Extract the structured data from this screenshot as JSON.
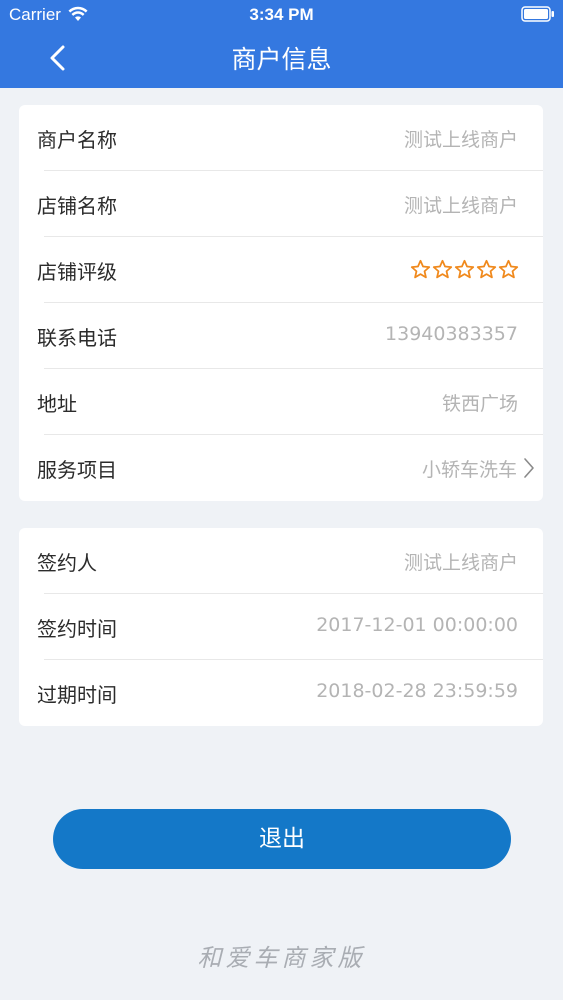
{
  "status_bar": {
    "carrier": "Carrier",
    "time": "3:34 PM"
  },
  "nav": {
    "title": "商户信息",
    "back_icon": "chevron-left-icon"
  },
  "merchant_info": {
    "rows": [
      {
        "label": "商户名称",
        "value": "测试上线商户"
      },
      {
        "label": "店铺名称",
        "value": "测试上线商户"
      },
      {
        "label": "店铺评级",
        "rating": 0,
        "rating_max": 5
      },
      {
        "label": "联系电话",
        "value": "13940383357"
      },
      {
        "label": "地址",
        "value": "铁西广场"
      },
      {
        "label": "服务项目",
        "value": "小轿车洗车"
      }
    ]
  },
  "contract_info": {
    "rows": [
      {
        "label": "签约人",
        "value": "测试上线商户"
      },
      {
        "label": "签约时间",
        "value": "2017-12-01 00:00:00"
      },
      {
        "label": "过期时间",
        "value": "2018-02-28 23:59:59"
      }
    ]
  },
  "logout": {
    "label": "退出"
  },
  "footer": {
    "brand": "和爱车商家版"
  },
  "colors": {
    "header": "#3478e0",
    "button": "#1478c8",
    "star": "#f0891c",
    "background": "#eff2f6"
  }
}
